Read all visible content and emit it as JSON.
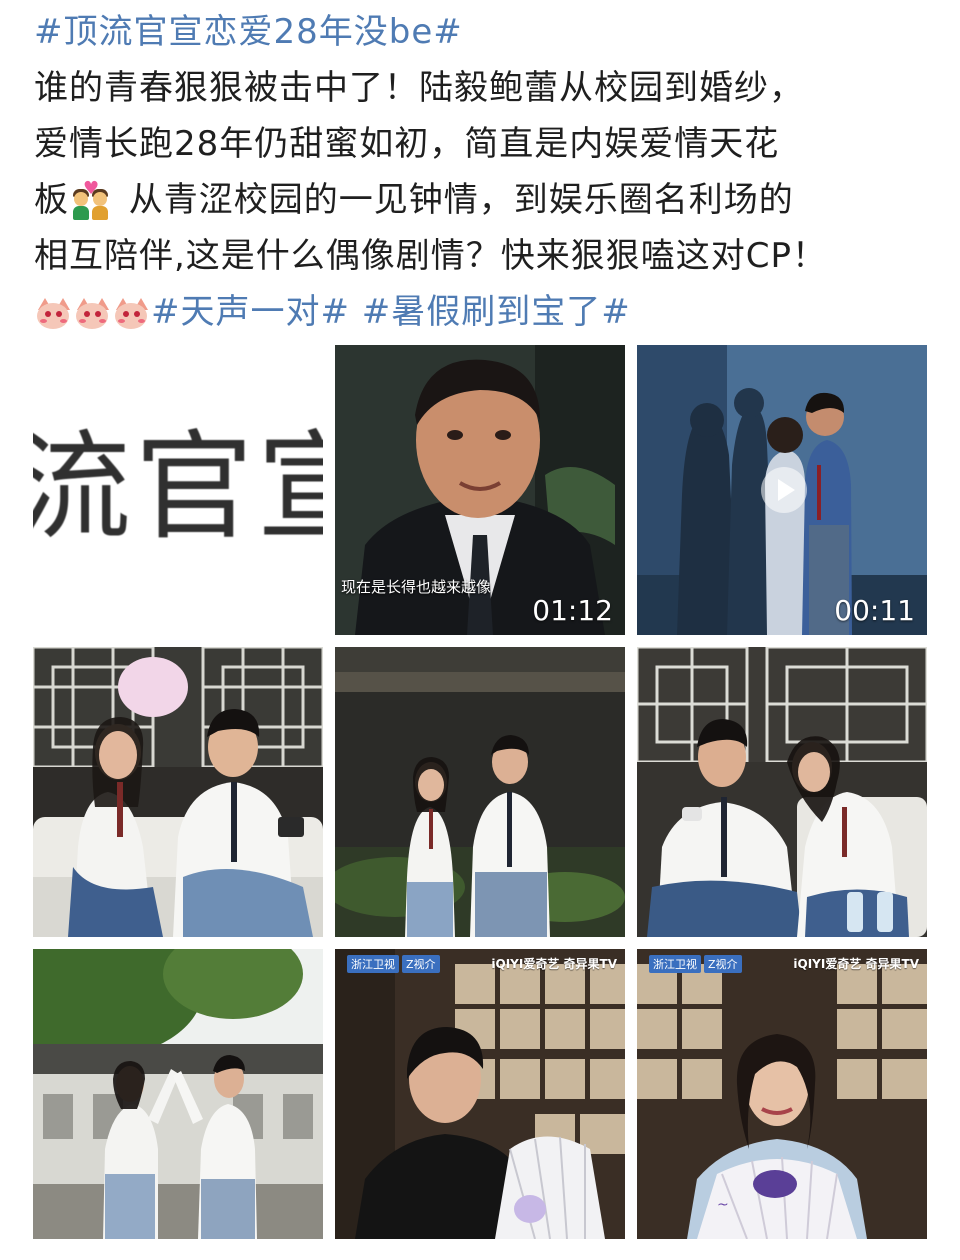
{
  "post": {
    "lines": [
      {
        "tag_open": "#",
        "tag_text": "顶流官宣恋爱28年没be",
        "tag_close": "#"
      },
      {
        "text": "谁的青春狠狠被击中了！陆毅鲍蕾从校园到婚纱，"
      },
      {
        "text": "爱情长跑28年仍甜蜜如初，简直是内娱爱情天花"
      },
      {
        "text_a": "板",
        "emoji": "couple-with-heart-emoji",
        "text_b": " 从青涩校园的一见钟情，到娱乐圈名利场的"
      },
      {
        "text": "相互陪伴,这是什么偶像剧情？快来狠狠嗑这对CP！"
      }
    ],
    "last_line": {
      "emojis": [
        "blushing-cat-emoji",
        "blushing-cat-emoji",
        "blushing-cat-emoji"
      ],
      "tags": [
        "#天声一对#",
        "#暑假刷到宝了#"
      ]
    }
  },
  "media": {
    "tiles": [
      {
        "kind": "text-crop",
        "text": "流官宣"
      },
      {
        "kind": "video",
        "duration": "01:12",
        "subtitle": "现在是长得也越来越像"
      },
      {
        "kind": "video",
        "duration": "00:11"
      },
      {
        "kind": "photo"
      },
      {
        "kind": "photo"
      },
      {
        "kind": "photo"
      },
      {
        "kind": "photo"
      },
      {
        "kind": "photo",
        "logo_left": [
          "浙江卫视",
          "Z视介"
        ],
        "logo_right": "iQIYI爱奇艺 奇异果TV"
      },
      {
        "kind": "photo",
        "logo_left": [
          "浙江卫视",
          "Z视介"
        ],
        "logo_right": "iQIYI爱奇艺 奇异果TV"
      }
    ]
  },
  "colors": {
    "tag": "#4f7bb3",
    "text": "#1f1f1f",
    "background": "#ffffff"
  }
}
